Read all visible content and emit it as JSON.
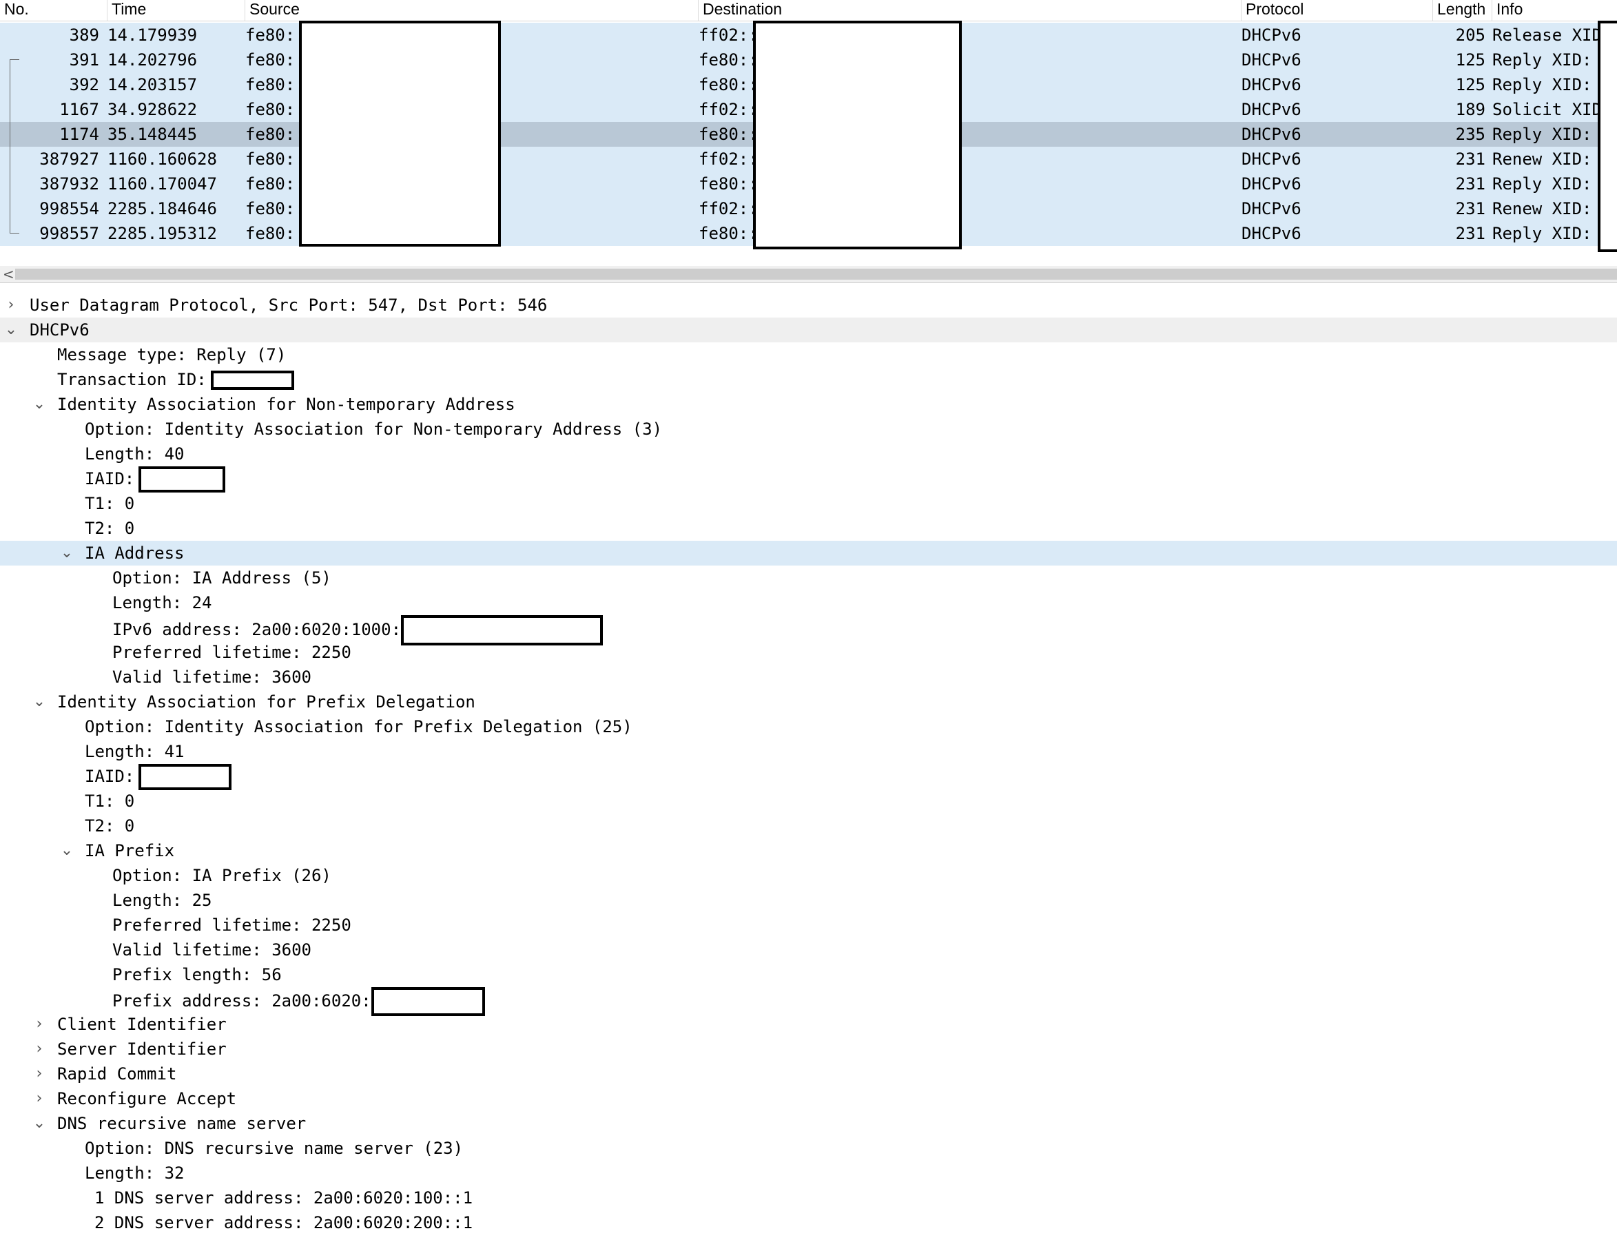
{
  "columns": {
    "no": "No.",
    "time": "Time",
    "source": "Source",
    "destination": "Destination",
    "protocol": "Protocol",
    "length": "Length",
    "info": "Info"
  },
  "packets": [
    {
      "no": "389",
      "time": "14.179939",
      "src": "fe80::",
      "dst": "ff02::",
      "proto": "DHCPv6",
      "len": "205",
      "info": "Release XID"
    },
    {
      "no": "391",
      "time": "14.202796",
      "src": "fe80::",
      "dst": "fe80::",
      "proto": "DHCPv6",
      "len": "125",
      "info": "Reply XID:"
    },
    {
      "no": "392",
      "time": "14.203157",
      "src": "fe80::",
      "dst": "fe80::",
      "proto": "DHCPv6",
      "len": "125",
      "info": "Reply XID:"
    },
    {
      "no": "1167",
      "time": "34.928622",
      "src": "fe80::",
      "dst": "ff02::",
      "proto": "DHCPv6",
      "len": "189",
      "info": "Solicit XID"
    },
    {
      "no": "1174",
      "time": "35.148445",
      "src": "fe80::",
      "dst": "fe80::",
      "proto": "DHCPv6",
      "len": "235",
      "info": "Reply XID:",
      "selected": true
    },
    {
      "no": "387927",
      "time": "1160.160628",
      "src": "fe80::",
      "dst": "ff02::",
      "proto": "DHCPv6",
      "len": "231",
      "info": "Renew XID:"
    },
    {
      "no": "387932",
      "time": "1160.170047",
      "src": "fe80::",
      "dst": "fe80::",
      "proto": "DHCPv6",
      "len": "231",
      "info": "Reply XID:"
    },
    {
      "no": "998554",
      "time": "2285.184646",
      "src": "fe80::",
      "dst": "ff02::",
      "proto": "DHCPv6",
      "len": "231",
      "info": "Renew XID:"
    },
    {
      "no": "998557",
      "time": "2285.195312",
      "src": "fe80::",
      "dst": "fe80::",
      "proto": "DHCPv6",
      "len": "231",
      "info": "Reply XID:"
    }
  ],
  "scroll_left_arrow": "<",
  "details": {
    "udp": "User Datagram Protocol, Src Port: 547, Dst Port: 546",
    "dhcpv6": "DHCPv6",
    "msg_type": "Message type: Reply (7)",
    "transaction_id": "Transaction ID:",
    "ia_na": "Identity Association for Non-temporary Address",
    "ia_na_option": "Option: Identity Association for Non-temporary Address (3)",
    "ia_na_length": "Length: 40",
    "ia_na_iaid": "IAID:",
    "ia_na_t1": "T1: 0",
    "ia_na_t2": "T2: 0",
    "ia_addr": "IA Address",
    "ia_addr_option": "Option: IA Address (5)",
    "ia_addr_length": "Length: 24",
    "ia_addr_ipv6": "IPv6 address: 2a00:6020:1000:",
    "ia_addr_pref": "Preferred lifetime: 2250",
    "ia_addr_valid": "Valid lifetime: 3600",
    "ia_pd": "Identity Association for Prefix Delegation",
    "ia_pd_option": "Option: Identity Association for Prefix Delegation (25)",
    "ia_pd_length": "Length: 41",
    "ia_pd_iaid": "IAID:",
    "ia_pd_t1": "T1: 0",
    "ia_pd_t2": "T2: 0",
    "ia_prefix": "IA Prefix",
    "ia_prefix_option": "Option: IA Prefix (26)",
    "ia_prefix_length": "Length: 25",
    "ia_prefix_pref": "Preferred lifetime: 2250",
    "ia_prefix_valid": "Valid lifetime: 3600",
    "ia_prefix_len": "Prefix length: 56",
    "ia_prefix_addr": "Prefix address: 2a00:6020:",
    "client_id": "Client Identifier",
    "server_id": "Server Identifier",
    "rapid_commit": "Rapid Commit",
    "reconf_accept": "Reconfigure Accept",
    "dns": "DNS recursive name server",
    "dns_option": "Option: DNS recursive name server (23)",
    "dns_length": "Length: 32",
    "dns_1": "1 DNS server address: 2a00:6020:100::1",
    "dns_2": "2 DNS server address: 2a00:6020:200::1"
  },
  "icons": {
    "collapsed": "chevron-right-icon",
    "expanded": "chevron-down-icon"
  }
}
